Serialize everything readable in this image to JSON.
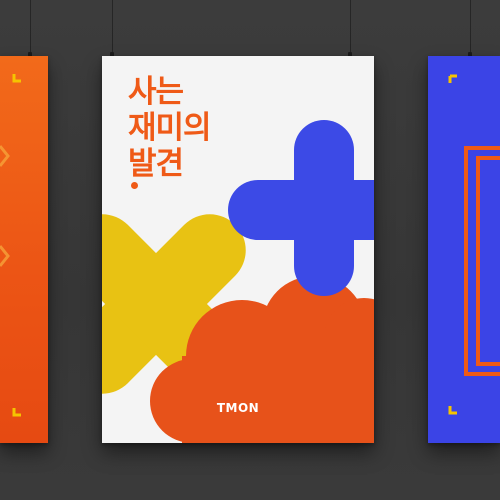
{
  "scene": {
    "background_color": "#3a3a3a",
    "poster_count": 3
  },
  "posters": {
    "left": {
      "color": "#ec5515",
      "accent_color": "#f5c400"
    },
    "center": {
      "background_color": "#f4f4f4",
      "headline_lines": [
        "사는",
        "재미의",
        "발견"
      ],
      "headline_color": "#ef5a17",
      "brand": "TMON",
      "shapes": {
        "plus_color": "#3c4ae6",
        "x_color": "#e8c213",
        "cloud_color": "#e7521a"
      }
    },
    "right": {
      "color": "#3b44e6",
      "accent_color": "#f5c400",
      "letter_color": "#ef5a17"
    }
  }
}
